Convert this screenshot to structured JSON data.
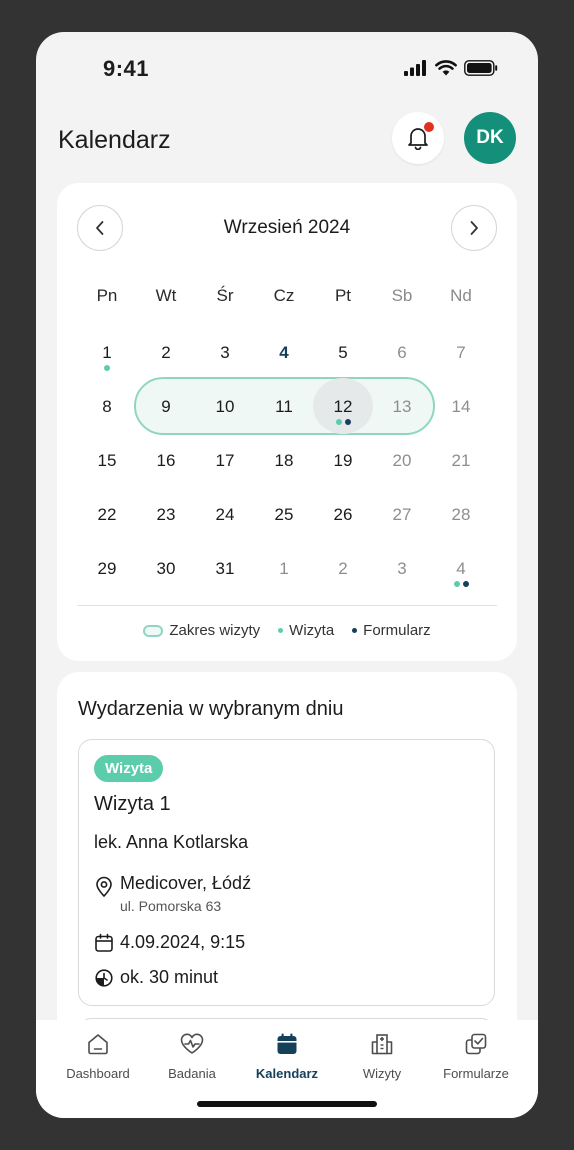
{
  "status": {
    "time": "9:41"
  },
  "header": {
    "title": "Kalendarz",
    "avatar_initials": "DK"
  },
  "calendar": {
    "month_label": "Wrzesień 2024",
    "weekdays": [
      "Pn",
      "Wt",
      "Śr",
      "Cz",
      "Pt",
      "Sb",
      "Nd"
    ],
    "weeks": [
      [
        "1",
        "2",
        "3",
        "4",
        "5",
        "6",
        "7"
      ],
      [
        "8",
        "9",
        "10",
        "11",
        "12",
        "13",
        "14"
      ],
      [
        "15",
        "16",
        "17",
        "18",
        "19",
        "20",
        "21"
      ],
      [
        "22",
        "23",
        "24",
        "25",
        "26",
        "27",
        "28"
      ],
      [
        "29",
        "30",
        "31",
        "1",
        "2",
        "3",
        "4"
      ]
    ],
    "legend": {
      "range": "Zakres wizyty",
      "visit": "Wizyta",
      "form": "Formularz"
    }
  },
  "events": {
    "heading": "Wydarzenia w wybranym dniu",
    "card": {
      "badge": "Wizyta",
      "title": "Wizyta 1",
      "doctor": "lek. Anna Kotlarska",
      "location": "Medicover, Łódź",
      "address": "ul. Pomorska 63",
      "datetime": "4.09.2024, 9:15",
      "duration": "ok. 30 minut"
    }
  },
  "tabbar": {
    "dashboard": "Dashboard",
    "badania": "Badania",
    "kalendarz": "Kalendarz",
    "wizyty": "Wizyty",
    "formularze": "Formularze"
  },
  "colors": {
    "accent": "#14907a",
    "visit": "#5ccdaa",
    "form": "#14405a",
    "alert": "#e0321f"
  }
}
